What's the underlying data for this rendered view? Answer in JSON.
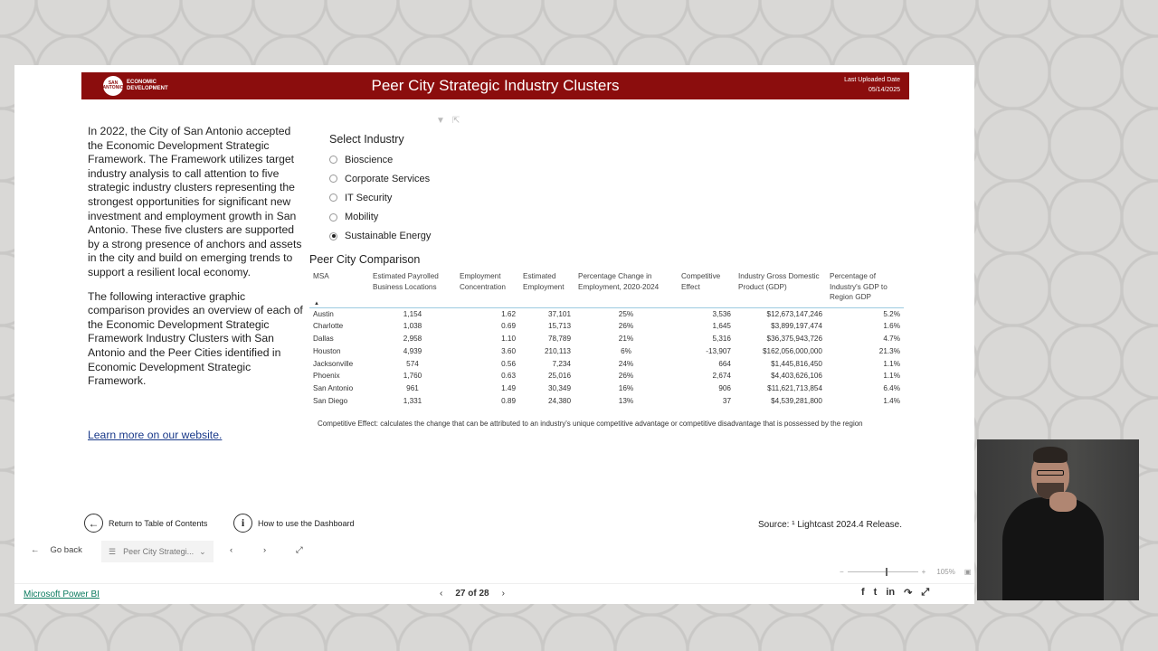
{
  "banner": {
    "logo_text": "SAN ANTONIO ECONOMIC DEVELOPMENT",
    "logo_line1": "ECONOMIC",
    "logo_line2": "DEVELOPMENT",
    "logo_mark": "SAN ANTONIO",
    "title": "Peer City Strategic Industry Clusters",
    "upload_label": "Last Uploaded Date",
    "upload_date": "05/14/2025",
    "background": "#8b0d0d"
  },
  "intro": {
    "paragraph1": "In 2022, the City of San Antonio accepted the Economic Development Strategic Framework. The Framework utilizes target industry analysis to call attention to five strategic industry clusters representing the strongest opportunities for significant new investment and employment growth in San Antonio. These five clusters are supported by a strong presence of anchors and assets in the city and build on emerging trends to support a resilient local economy.",
    "paragraph2": "The following interactive graphic comparison provides an overview of each of the Economic Development Strategic Framework Industry Clusters with San Antonio and the Peer Cities identified in Economic Development Strategic Framework.",
    "learn_more": "Learn more on our website."
  },
  "filter": {
    "title": "Select Industry",
    "options": [
      "Bioscience",
      "Corporate Services",
      "IT Security",
      "Mobility",
      "Sustainable Energy"
    ],
    "selected": "Sustainable Energy",
    "icons": [
      "filter-icon",
      "expand-icon"
    ]
  },
  "comparison": {
    "title": "Peer City Comparison",
    "columns": [
      "MSA",
      "Estimated Payrolled Business Locations",
      "Employment Concentration",
      "Estimated Employment",
      "Percentage Change in Employment, 2020-2024",
      "Competitive Effect",
      "Industry Gross Domestic Product (GDP)",
      "Percentage of Industry's GDP to Region GDP"
    ],
    "rows": [
      [
        "Austin",
        "1,154",
        "1.62",
        "37,101",
        "25%",
        "3,536",
        "$12,673,147,246",
        "5.2%"
      ],
      [
        "Charlotte",
        "1,038",
        "0.69",
        "15,713",
        "26%",
        "1,645",
        "$3,899,197,474",
        "1.6%"
      ],
      [
        "Dallas",
        "2,958",
        "1.10",
        "78,789",
        "21%",
        "5,316",
        "$36,375,943,726",
        "4.7%"
      ],
      [
        "Houston",
        "4,939",
        "3.60",
        "210,113",
        "6%",
        "-13,907",
        "$162,056,000,000",
        "21.3%"
      ],
      [
        "Jacksonville",
        "574",
        "0.56",
        "7,234",
        "24%",
        "664",
        "$1,445,816,450",
        "1.1%"
      ],
      [
        "Phoenix",
        "1,760",
        "0.63",
        "25,016",
        "26%",
        "2,674",
        "$4,403,626,106",
        "1.1%"
      ],
      [
        "San Antonio",
        "961",
        "1.49",
        "30,349",
        "16%",
        "906",
        "$11,621,713,854",
        "6.4%"
      ],
      [
        "San Diego",
        "1,331",
        "0.89",
        "24,380",
        "13%",
        "37",
        "$4,539,281,800",
        "1.4%"
      ]
    ],
    "footnote": "Competitive Effect: calculates the change that can be attributed to an industry's unique competitive advantage or competitive disadvantage that is possessed by the region"
  },
  "footer": {
    "return_label": "Return to Table of Contents",
    "howto_label": "How to use the Dashboard",
    "source": "Source: ¹ Lightcast 2024.4 Release."
  },
  "pbi": {
    "go_back": "Go back",
    "page_tab": "Peer City Strategi...",
    "zoom": "105%",
    "brand": "Microsoft Power BI",
    "page_indicator": "27 of 28",
    "share_icons": [
      "facebook-icon",
      "twitter-icon",
      "linkedin-icon",
      "share-icon",
      "expand-icon"
    ]
  }
}
